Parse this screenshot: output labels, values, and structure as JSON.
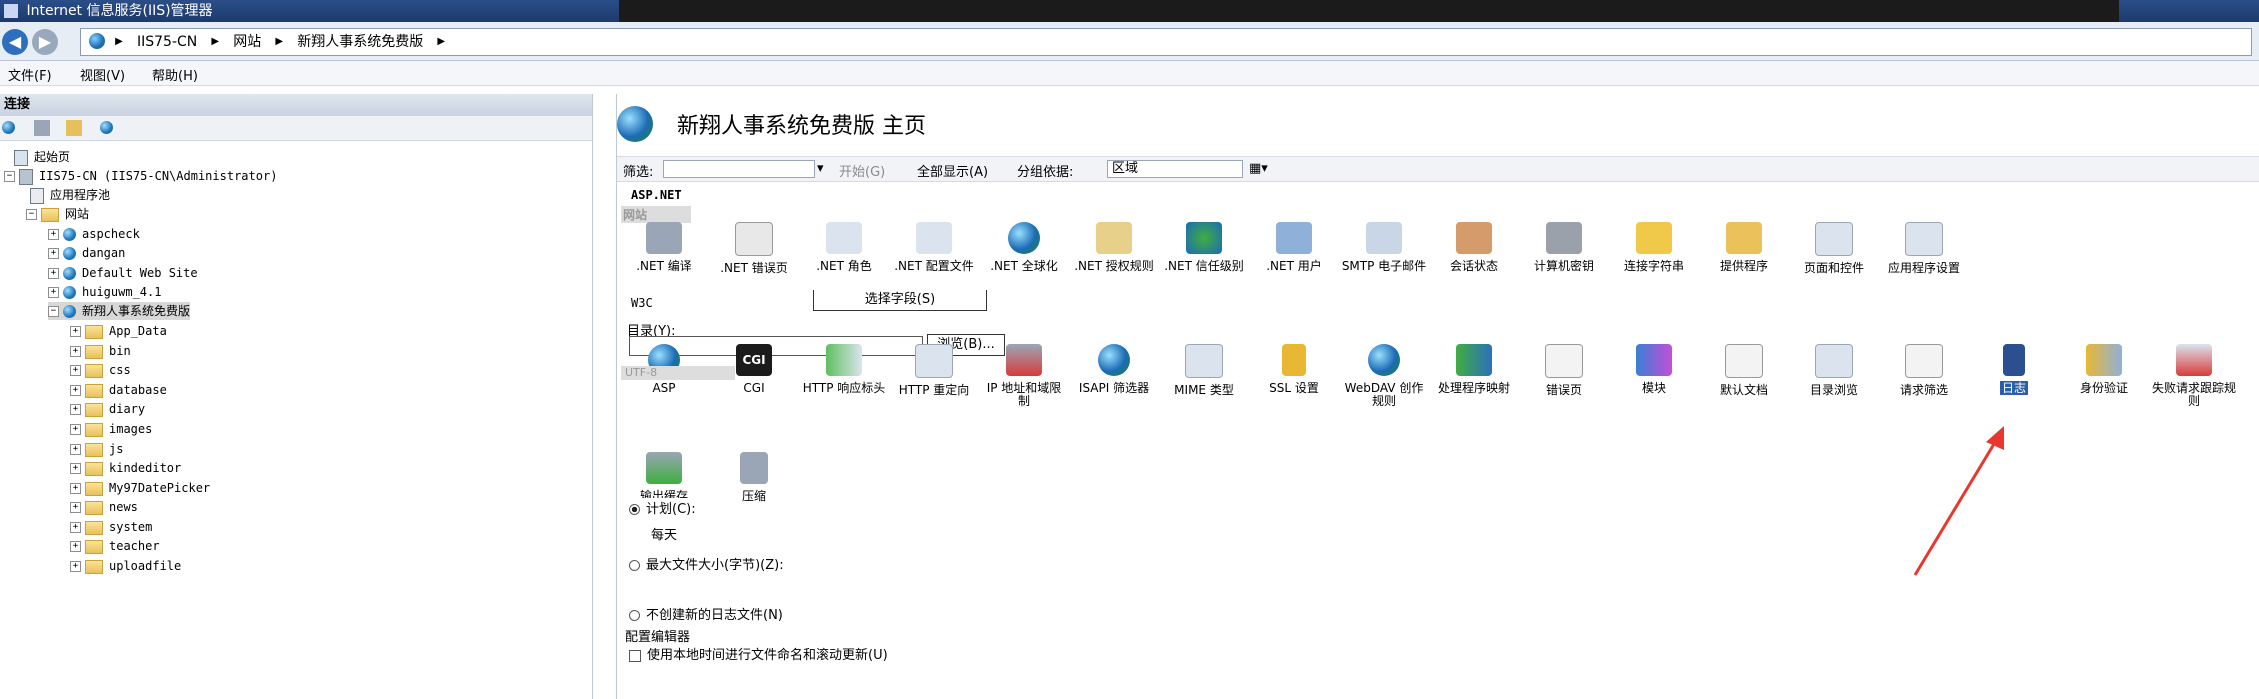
{
  "window": {
    "title": "Internet 信息服务(IIS)管理器"
  },
  "address": {
    "crumbs": [
      "IIS75-CN",
      "网站",
      "新翔人事系统免费版"
    ]
  },
  "menu": {
    "file": "文件(F)",
    "view": "视图(V)",
    "help": "帮助(H)"
  },
  "connections": {
    "header": "连接",
    "tree": [
      {
        "label": "起始页"
      },
      {
        "label": "IIS75-CN (IIS75-CN\\Administrator)"
      },
      {
        "label": "应用程序池"
      },
      {
        "label": "网站"
      },
      {
        "label": "aspcheck"
      },
      {
        "label": "dangan"
      },
      {
        "label": "Default Web Site"
      },
      {
        "label": "huiguwm_4.1"
      },
      {
        "label": "新翔人事系统免费版"
      },
      {
        "label": "App_Data"
      },
      {
        "label": "bin"
      },
      {
        "label": "css"
      },
      {
        "label": "database"
      },
      {
        "label": "diary"
      },
      {
        "label": "images"
      },
      {
        "label": "js"
      },
      {
        "label": "kindeditor"
      },
      {
        "label": "My97DatePicker"
      },
      {
        "label": "news"
      },
      {
        "label": "system"
      },
      {
        "label": "teacher"
      },
      {
        "label": "uploadfile"
      }
    ]
  },
  "main": {
    "title": "新翔人事系统免费版 主页",
    "filter": {
      "label": "筛选:",
      "start": "开始(G)",
      "show_all": "全部显示(A)",
      "group_by": "分组依据:",
      "group_value": "区域"
    },
    "section_aspnet": "ASP.NET",
    "section_site_ghost": "网站",
    "features_row1": [
      {
        "label": ".NET 编译"
      },
      {
        "label": ".NET 错误页"
      },
      {
        "label": ".NET 角色"
      },
      {
        "label": ".NET 配置文件"
      },
      {
        "label": ".NET 全球化"
      },
      {
        "label": ".NET 授权规则"
      },
      {
        "label": ".NET 信任级别"
      },
      {
        "label": ".NET 用户"
      },
      {
        "label": "SMTP 电子邮件"
      },
      {
        "label": "会话状态"
      },
      {
        "label": "计算机密钥"
      },
      {
        "label": "连接字符串"
      },
      {
        "label": "提供程序"
      },
      {
        "label": "页面和控件"
      },
      {
        "label": "应用程序设置"
      }
    ],
    "select_fields": "选择字段(S)",
    "w3c": "W3C",
    "directory_label": "目录(Y):",
    "browse": "浏览(B)...",
    "utf8": "UTF-8",
    "cgi_text": "CGI",
    "features_row2": [
      {
        "label": "ASP"
      },
      {
        "label": "CGI"
      },
      {
        "label": "HTTP 响应标头"
      },
      {
        "label": "HTTP 重定向"
      },
      {
        "label": "IP 地址和域限制"
      },
      {
        "label": "ISAPI 筛选器"
      },
      {
        "label": "MIME 类型"
      },
      {
        "label": "SSL 设置"
      },
      {
        "label": "WebDAV 创作规则"
      },
      {
        "label": "处理程序映射"
      },
      {
        "label": "错误页"
      },
      {
        "label": "模块"
      },
      {
        "label": "默认文档"
      },
      {
        "label": "目录浏览"
      },
      {
        "label": "请求筛选"
      },
      {
        "label": "日志"
      },
      {
        "label": "身份验证"
      },
      {
        "label": "失败请求跟踪规则"
      }
    ],
    "features_row3": [
      {
        "label": "输出缓存"
      },
      {
        "label": "压缩"
      }
    ],
    "schedule": "计划(C):",
    "daily": "每天",
    "max_size": "最大文件大小(字节)(Z):",
    "no_new_file": "不创建新的日志文件(N)",
    "editor": "配置编辑器",
    "local_time": "使用本地时间进行文件命名和滚动更新(U)",
    "arrow_color": "#e8382d"
  }
}
